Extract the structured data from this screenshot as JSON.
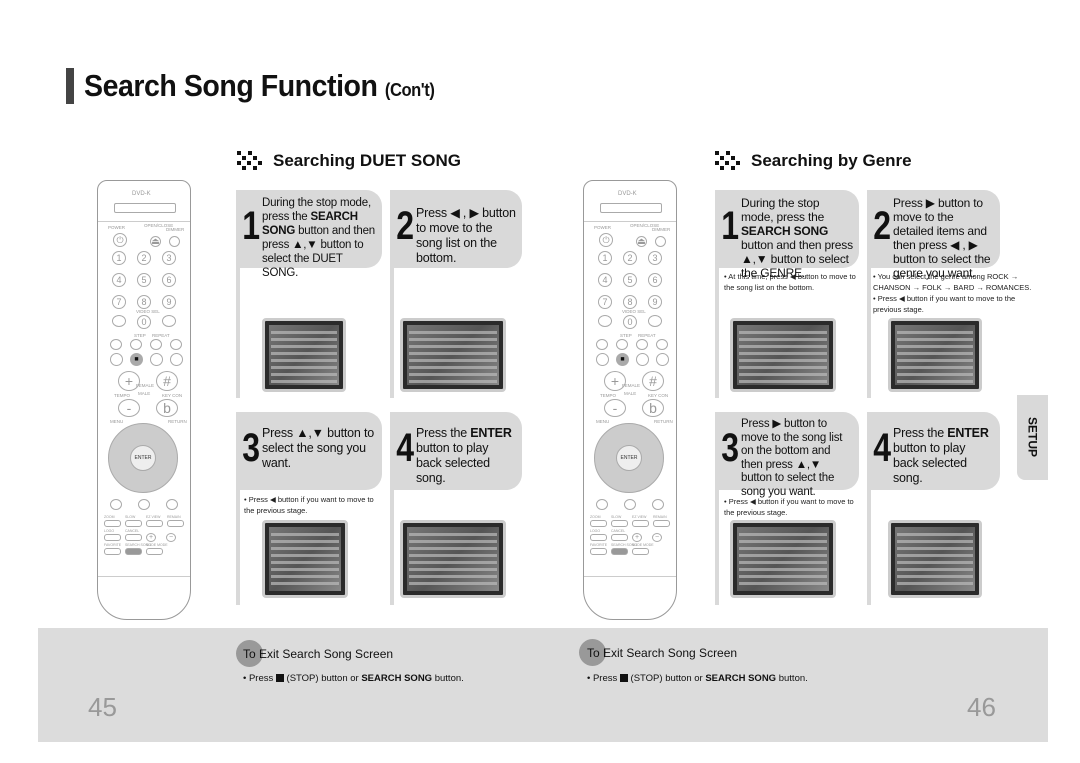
{
  "title": {
    "main": "Search Song Function",
    "suffix": "(Con't)"
  },
  "left": {
    "heading": "Searching DUET SONG",
    "steps": [
      {
        "num": "1",
        "pre": "During the stop mode, press the ",
        "bold1": "SEARCH SONG",
        "post": " button and then press ▲,▼ button to select the DUET SONG."
      },
      {
        "num": "2",
        "text": "Press ◀ , ▶ button to move to the song list on the bottom."
      },
      {
        "num": "3",
        "text": "Press ▲,▼ button to select the song you want."
      },
      {
        "num": "4",
        "pre": "Press the ",
        "bold1": "ENTER",
        "post": " button to play back selected song."
      }
    ],
    "note3": "• Press ◀ button if you want to move to the previous stage.",
    "exit_title": "To Exit Search Song Screen",
    "exit_pre": "• Press ",
    "exit_mid": " (STOP) button or ",
    "exit_bold": "SEARCH SONG",
    "exit_post": " button.",
    "page": "45"
  },
  "right": {
    "heading": "Searching by Genre",
    "steps": [
      {
        "num": "1",
        "pre": "During the stop mode, press the ",
        "bold1": "SEARCH SONG",
        "post": " button and then press ▲,▼ button to select the GENRE."
      },
      {
        "num": "2",
        "text": "Press ▶ button to move to the detailed items and then press ◀ , ▶ button to select the genre you want."
      },
      {
        "num": "3",
        "text": "Press ▶ button to move to the song list on the bottom and then press ▲,▼ button to select the song you want."
      },
      {
        "num": "4",
        "pre": "Press the ",
        "bold1": "ENTER",
        "post": " button to play back selected song."
      }
    ],
    "note1": "• At this time, press ◀ button to move to the song list on the bottom.",
    "note2a": "• You can select the genre among ROCK → CHANSON → FOLK → BARD → ROMANCES.",
    "note2b": "• Press ◀ button if you want to move to the previous stage.",
    "note3": "• Press ◀ button if you want to move to the previous stage.",
    "exit_title": "To Exit Search Song Screen",
    "exit_pre": "• Press ",
    "exit_mid": " (STOP) button or ",
    "exit_bold": "SEARCH SONG",
    "exit_post": " button.",
    "page": "46"
  },
  "tab": "SETUP",
  "remote": {
    "brand": "DVD-K",
    "labels": [
      "POWER",
      "OPEN/CLOSE",
      "DIMMER",
      "VIDEO SEL",
      "STEP",
      "REPEAT",
      "FEMALE",
      "TEMPO",
      "MALE",
      "KEY CON",
      "MENU",
      "RETURN",
      "ZOOM",
      "SLOW",
      "EZ VIEW",
      "REMAIN",
      "LOGO",
      "CANCEL",
      "FAVORITE",
      "SEARCH SONG",
      "SLIDE MODE"
    ],
    "keys": [
      "1",
      "2",
      "3",
      "4",
      "5",
      "6",
      "7",
      "8",
      "9",
      "0",
      "+",
      "#",
      "-",
      "b",
      "ENTER"
    ],
    "highlight": {
      "left": "stop / search song",
      "right": "stop / search song"
    }
  }
}
